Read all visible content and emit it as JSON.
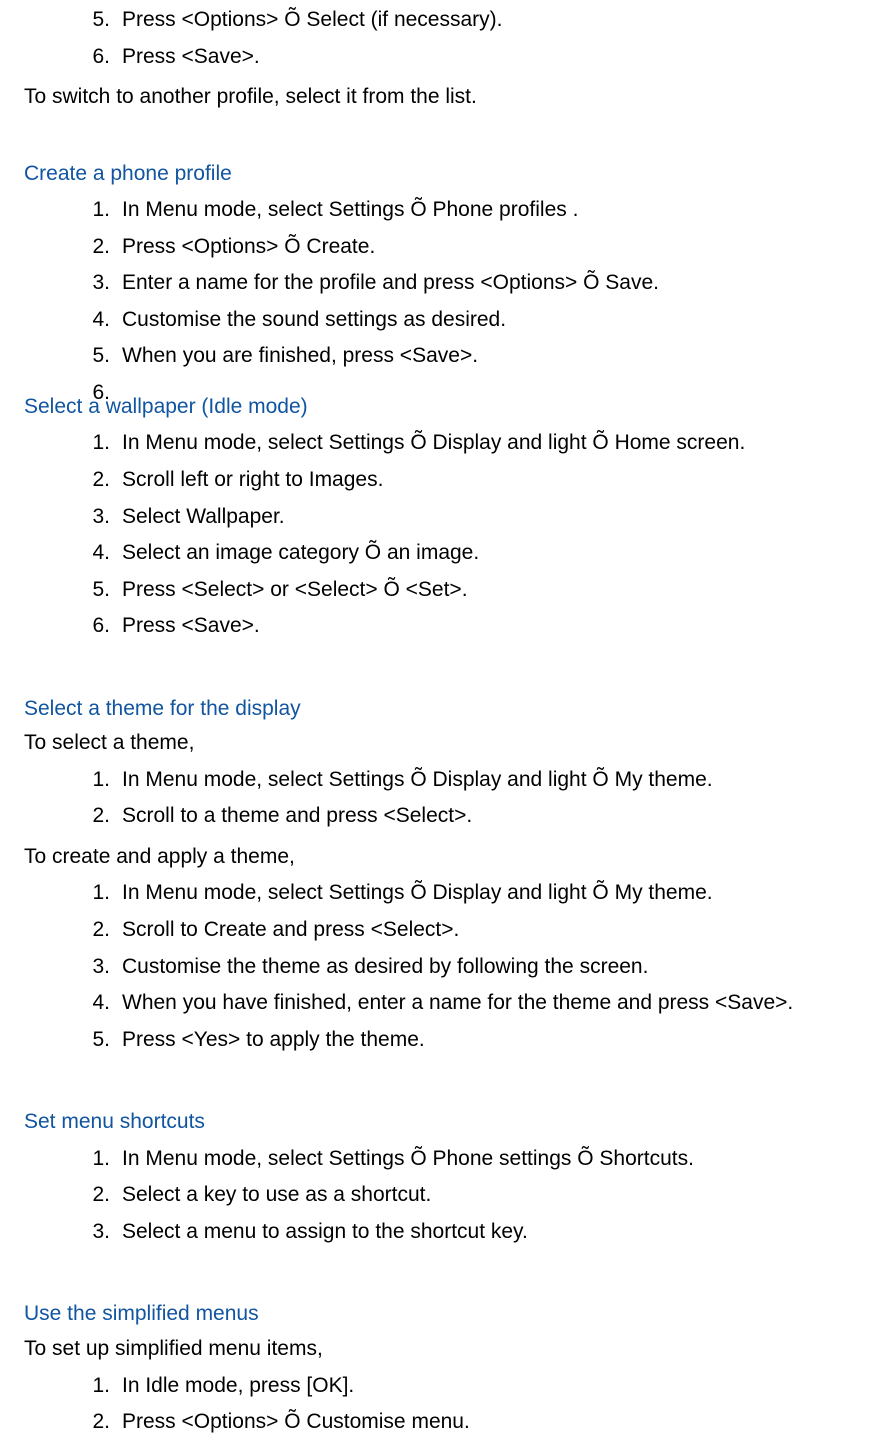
{
  "sections": [
    {
      "type": "list",
      "start": 5,
      "items": [
        "Press <Options> Õ Select (if necessary).",
        "Press <Save>."
      ]
    },
    {
      "type": "text",
      "value": "To switch to another profile, select it from the list."
    },
    {
      "type": "spacer"
    },
    {
      "type": "heading",
      "value": "Create a phone profile"
    },
    {
      "type": "list",
      "start": 1,
      "items": [
        "In Menu mode, select Settings Õ Phone profiles .",
        "Press <Options> Õ Create.",
        "Enter a name for the profile and press <Options> Õ Save.",
        "Customise the sound settings as desired.",
        "When you are finished, press <Save>.",
        ""
      ]
    },
    {
      "type": "heading",
      "value": "Select a wallpaper (Idle mode)"
    },
    {
      "type": "list",
      "start": 1,
      "items": [
        "In Menu mode, select Settings Õ Display and light Õ Home screen.",
        "Scroll left or right to Images.",
        "Select Wallpaper.",
        "Select an image category Õ an image.",
        "Press <Select> or <Select> Õ <Set>.",
        "Press <Save>."
      ]
    },
    {
      "type": "spacer"
    },
    {
      "type": "heading",
      "value": "Select a theme for the display"
    },
    {
      "type": "text",
      "value": "To select a theme,"
    },
    {
      "type": "list",
      "start": 1,
      "items": [
        "In Menu mode, select Settings Õ Display and light Õ My theme.",
        "Scroll to a theme and press <Select>."
      ]
    },
    {
      "type": "text",
      "value": "To create and apply a theme,"
    },
    {
      "type": "list",
      "start": 1,
      "items": [
        "In Menu mode, select Settings Õ Display and light Õ My theme.",
        "Scroll to Create and press <Select>.",
        "Customise the theme as desired by following the screen.",
        "When you have finished, enter a name for the theme and press <Save>.",
        "Press <Yes> to apply the theme."
      ]
    },
    {
      "type": "spacer"
    },
    {
      "type": "heading",
      "value": "Set menu shortcuts"
    },
    {
      "type": "list",
      "start": 1,
      "items": [
        "In Menu mode, select Settings Õ Phone settings Õ Shortcuts.",
        "Select a key to use as a shortcut.",
        "Select a menu to assign to the shortcut key."
      ]
    },
    {
      "type": "spacer"
    },
    {
      "type": "heading",
      "value": "Use the simplified menus"
    },
    {
      "type": "text",
      "value": "To set up simplified menu items,"
    },
    {
      "type": "list",
      "start": 1,
      "items": [
        "In Idle mode, press [OK].",
        "Press <Options> Õ Customise menu."
      ]
    }
  ]
}
